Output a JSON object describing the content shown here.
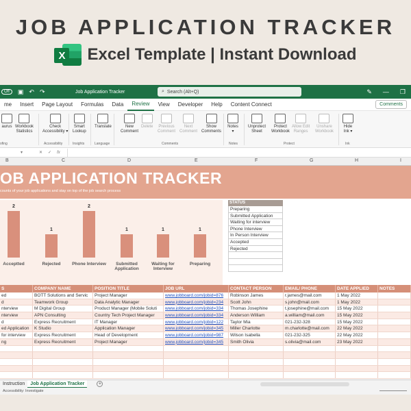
{
  "banner": {
    "title": "JOB APPLICATION TRACKER",
    "subtitle": "Excel Template | Instant Download",
    "logo_letter": "X"
  },
  "window": {
    "autosave": "Off",
    "doc_title": "Job Application Tracker",
    "search_placeholder": "Search (Alt+Q)",
    "menu": [
      "me",
      "Insert",
      "Page Layout",
      "Formulas",
      "Data",
      "Review",
      "View",
      "Developer",
      "Help",
      "Content Connect"
    ],
    "active_menu": "Review",
    "comments_label": "Comments",
    "ribbon_buttons": [
      {
        "label": "aurus",
        "label2": "",
        "disabled": false
      },
      {
        "label": "Workbook",
        "label2": "Statistics",
        "disabled": false
      },
      {
        "label": "Check",
        "label2": "Accessibility ▾",
        "disabled": false
      },
      {
        "label": "Smart",
        "label2": "Lookup",
        "disabled": false
      },
      {
        "label": "Translate",
        "label2": "",
        "disabled": false
      },
      {
        "label": "New",
        "label2": "Comment",
        "disabled": false
      },
      {
        "label": "Delete",
        "label2": "",
        "disabled": true
      },
      {
        "label": "Previous",
        "label2": "Comment",
        "disabled": true
      },
      {
        "label": "Next",
        "label2": "Comment",
        "disabled": true
      },
      {
        "label": "Show",
        "label2": "Comments",
        "disabled": false
      },
      {
        "label": "Notes",
        "label2": "▾",
        "disabled": false
      },
      {
        "label": "Unprotect",
        "label2": "Sheet",
        "disabled": false
      },
      {
        "label": "Protect",
        "label2": "Workbook",
        "disabled": false
      },
      {
        "label": "Allow Edit",
        "label2": "Ranges",
        "disabled": true
      },
      {
        "label": "Unshare",
        "label2": "Workbook",
        "disabled": true
      },
      {
        "label": "Hide",
        "label2": "Ink ▾",
        "disabled": false
      }
    ],
    "ribbon_groups": [
      "ofing",
      "Accessibility",
      "Insights",
      "Language",
      "Comments",
      "Notes",
      "Protect",
      "Ink"
    ],
    "columns": [
      "B",
      "C",
      "D",
      "E",
      "F",
      "G",
      "H",
      "I"
    ]
  },
  "sheet": {
    "title": "OB APPLICATION TRACKER",
    "subtitle": "counts of your job applications and stay on top of the job search process",
    "status_header": "STATUS",
    "status_items": [
      "Preparing",
      "Submitted Application",
      "Waiting for interview",
      "Phone Interview",
      "In Person Interview",
      "Accepted",
      "Rejected",
      "",
      "",
      ""
    ],
    "table_headers": [
      "S",
      "COMPANY NAME",
      "POSITION TITLE",
      "JOB URL",
      "CONTACT PERSON",
      "EMAIL/ PHONE",
      "DATE APPLIED",
      "NOTES"
    ],
    "rows": [
      [
        "ed",
        "BOTT Solutions and Servic",
        "Project Manager",
        "www.jobboard.com/jobid=876",
        "Robinson James",
        "r.james@mail.com",
        "1 May 2022",
        ""
      ],
      [
        "d",
        "Teamwork Group",
        "Data Analytic Manager",
        "www.jobboard.com/jobid=234",
        "Scott John",
        "s.john@mail.com",
        "1 May 2022",
        ""
      ],
      [
        "nterview",
        "M Digital Group",
        "Product Manager (Mobile Soluti",
        "www.jobboard.com/jobid=334",
        "Thomas Josephine",
        "t.josephine@mail.com",
        "15 May 2022",
        ""
      ],
      [
        "nterview",
        "APN Consulting",
        "Country Tech Project Manager",
        "www.jobboard.com/jobid=334",
        "Anderson William",
        "a.william@mail.com",
        "15 May 2022",
        ""
      ],
      [
        "d",
        "Express Recruitment",
        "IT Manager",
        "www.jobboard.com/jobid=122",
        "Taylor Mia",
        "021-232-328",
        "15 May 2022",
        ""
      ],
      [
        "ed Application",
        "K Studio",
        "Application Manager",
        "www.jobboard.com/jobid=345",
        "Miller Charlotte",
        "m.charlotte@mail.com",
        "22 May 2022",
        ""
      ],
      [
        "for interview",
        "Express Recruitment",
        "Head of Development",
        "www.jobboard.com/jobid=987",
        "Wilson Isabella",
        "021-232-325",
        "22 May 2022",
        ""
      ],
      [
        "ng",
        "Express Recruitment",
        "Project Manager",
        "www.jobboard.com/jobid=345",
        "Smith Olivia",
        "s.olivia@mail.com",
        "23 May 2022",
        ""
      ],
      [
        "",
        "",
        "",
        "",
        "",
        "",
        "",
        ""
      ],
      [
        "",
        "",
        "",
        "",
        "",
        "",
        "",
        ""
      ],
      [
        "",
        "",
        "",
        "",
        "",
        "",
        "",
        ""
      ],
      [
        "",
        "",
        "",
        "",
        "",
        "",
        "",
        ""
      ],
      [
        "",
        "",
        "",
        "",
        "",
        "",
        "",
        ""
      ]
    ],
    "tabs": [
      "Instruction",
      "Job Application Tracker"
    ],
    "active_tab": "Job Application Tracker",
    "statusbar_text": "Accessibility: Investigate"
  },
  "chart_data": {
    "type": "bar",
    "categories": [
      "Acceptted",
      "Rejected",
      "Phone Interview",
      "Submitted Application",
      "Waiting for Interview",
      "Preparing"
    ],
    "values": [
      2,
      1,
      2,
      1,
      1,
      1
    ],
    "ylim": [
      0,
      2
    ],
    "grid": false,
    "legend": "none",
    "bar_color": "#d9907c"
  }
}
